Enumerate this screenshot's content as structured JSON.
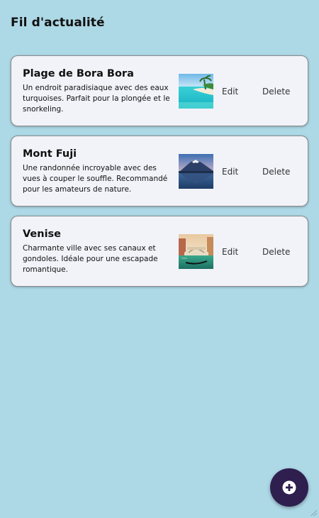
{
  "header": {
    "title": "Fil d'actualité"
  },
  "posts": [
    {
      "title": "Plage de Bora Bora",
      "description": "Un endroit paradisiaque avec des eaux turquoises. Parfait pour la plongée et le snorkeling.",
      "edit_label": "Edit",
      "delete_label": "Delete",
      "image_icon": "beach-photo"
    },
    {
      "title": "Mont Fuji",
      "description": "Une randonnée incroyable avec des vues à couper le souffle. Recommandé pour les amateurs de nature.",
      "edit_label": "Edit",
      "delete_label": "Delete",
      "image_icon": "mountain-photo"
    },
    {
      "title": "Venise",
      "description": "Charmante ville avec ses canaux et gondoles. Idéale pour une escapade romantique.",
      "edit_label": "Edit",
      "delete_label": "Delete",
      "image_icon": "venice-photo"
    }
  ],
  "fab": {
    "icon": "plus-circle-icon"
  },
  "colors": {
    "background": "#add8e6",
    "card": "#f2f3f9",
    "fab": "#2e1f4f"
  }
}
